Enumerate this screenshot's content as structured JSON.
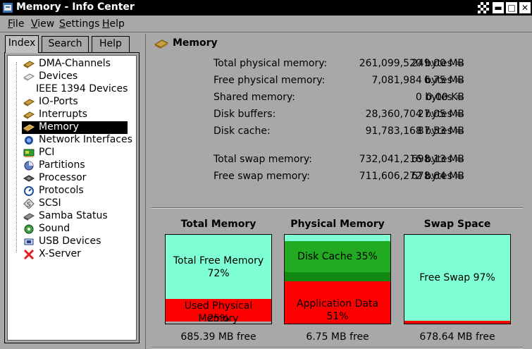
{
  "window": {
    "title": "Memory - Info Center",
    "buttons": [
      "minimize",
      "maximize",
      "close"
    ]
  },
  "menubar": {
    "items": [
      "File",
      "View",
      "Settings",
      "Help"
    ]
  },
  "tabs": [
    {
      "label": "Index",
      "active": true
    },
    {
      "label": "Search",
      "active": false
    },
    {
      "label": "Help",
      "active": false
    }
  ],
  "tree": {
    "items": [
      {
        "label": "DMA-Channels",
        "icon": "memory-chip-icon"
      },
      {
        "label": "Devices",
        "icon": "device-icon"
      },
      {
        "label": "IEEE 1394 Devices",
        "icon": ""
      },
      {
        "label": "IO-Ports",
        "icon": "memory-chip-icon"
      },
      {
        "label": "Interrupts",
        "icon": "memory-chip-icon"
      },
      {
        "label": "Memory",
        "icon": "memory-chip-icon",
        "selected": true
      },
      {
        "label": "Network Interfaces",
        "icon": "network-icon"
      },
      {
        "label": "PCI",
        "icon": "pci-card-icon"
      },
      {
        "label": "Partitions",
        "icon": "partitions-icon"
      },
      {
        "label": "Processor",
        "icon": "processor-icon"
      },
      {
        "label": "Protocols",
        "icon": "protocols-icon"
      },
      {
        "label": "SCSI",
        "icon": "scsi-icon"
      },
      {
        "label": "Samba Status",
        "icon": "samba-icon"
      },
      {
        "label": "Sound",
        "icon": "sound-icon"
      },
      {
        "label": "USB Devices",
        "icon": "usb-icon"
      },
      {
        "label": "X-Server",
        "icon": "x-server-icon"
      }
    ]
  },
  "panel": {
    "heading": "Memory",
    "rows": [
      {
        "label": "Total physical memory:",
        "bytes": "261,099,520 bytes =",
        "size": "249.00 MB"
      },
      {
        "label": "Free physical memory:",
        "bytes": "7,081,984 bytes =",
        "size": "6.75 MB"
      },
      {
        "label": "Shared memory:",
        "bytes": "0 bytes =",
        "size": "0.00 KB"
      },
      {
        "label": "Disk buffers:",
        "bytes": "28,360,704 bytes =",
        "size": "27.05 MB"
      },
      {
        "label": "Disk cache:",
        "bytes": "91,783,168 bytes =",
        "size": "87.53 MB"
      }
    ],
    "swap_rows": [
      {
        "label": "Total swap memory:",
        "bytes": "732,041,216 bytes =",
        "size": "698.13 MB"
      },
      {
        "label": "Free swap memory:",
        "bytes": "711,606,272 bytes =",
        "size": "678.64 MB"
      }
    ]
  },
  "graphs": [
    {
      "title": "Total Memory",
      "footer": "685.39 MB free",
      "segments": [
        {
          "label": "Total Free Memory",
          "percent_label": "72%",
          "fraction": 0.72,
          "color": "#7fffd4"
        },
        {
          "label": "Used Physical Memory",
          "percent_label": "25%",
          "fraction": 0.25,
          "color": "#ff0000"
        }
      ]
    },
    {
      "title": "Physical Memory",
      "footer": "6.75 MB free",
      "segments": [
        {
          "label": "",
          "percent_label": "",
          "fraction": 0.07,
          "color": "#7fffd4"
        },
        {
          "label": "Disk Cache 35%",
          "percent_label": "",
          "fraction": 0.35,
          "color": "#22aa22"
        },
        {
          "label": "",
          "percent_label": "",
          "fraction": 0.1,
          "color": "#118811"
        },
        {
          "label": "Application Data 51%",
          "percent_label": "",
          "fraction": 0.51,
          "color": "#ff0000"
        }
      ]
    },
    {
      "title": "Swap Space",
      "footer": "678.64 MB free",
      "segments": [
        {
          "label": "Free Swap 97%",
          "percent_label": "",
          "fraction": 0.97,
          "color": "#7fffd4"
        },
        {
          "label": "",
          "percent_label": "",
          "fraction": 0.03,
          "color": "#ff0000"
        }
      ]
    }
  ]
}
